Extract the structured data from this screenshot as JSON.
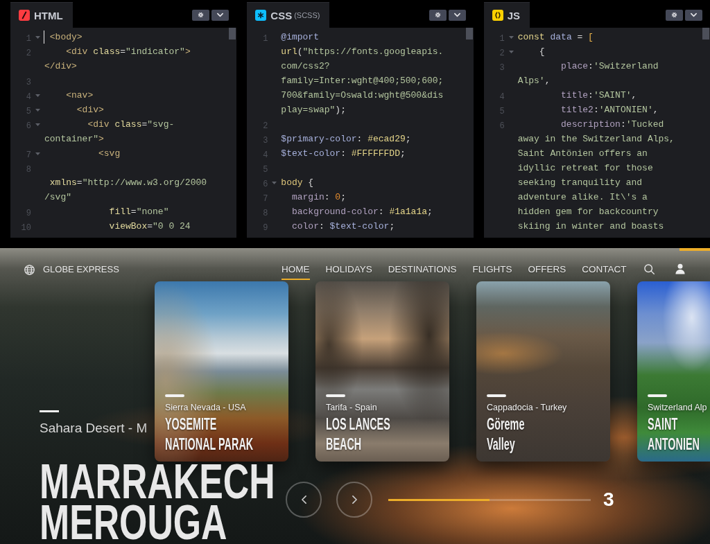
{
  "editors": [
    {
      "kind": "html",
      "label": "HTML",
      "lines": [
        {
          "number": "1",
          "fold": true,
          "cursor": true,
          "segments": [
            {
              "kind": "tag",
              "text": " <body>"
            }
          ]
        },
        {
          "number": "2",
          "fold": false,
          "segments": [
            {
              "kind": "tag",
              "text": "    <div"
            },
            {
              "kind": "attribute",
              "text": " class"
            },
            {
              "kind": "punctuation",
              "text": "="
            },
            {
              "kind": "string",
              "text": "\"indicator\""
            },
            {
              "kind": "tag",
              "text": ">\n</div>"
            }
          ]
        },
        {
          "number": "3",
          "fold": false
        },
        {
          "number": "4",
          "fold": true,
          "segments": [
            {
              "kind": "tag",
              "text": "    <nav>"
            }
          ]
        },
        {
          "number": "5",
          "fold": true,
          "segments": [
            {
              "kind": "tag",
              "text": "      <div>"
            }
          ]
        },
        {
          "number": "6",
          "fold": true,
          "segments": [
            {
              "kind": "tag",
              "text": "        <div"
            },
            {
              "kind": "attribute",
              "text": " class"
            },
            {
              "kind": "punctuation",
              "text": "="
            },
            {
              "kind": "string",
              "text": "\"svg-\ncontainer\""
            },
            {
              "kind": "tag",
              "text": ">"
            }
          ]
        },
        {
          "number": "7",
          "fold": true,
          "segments": [
            {
              "kind": "tag",
              "text": "          <svg"
            }
          ]
        },
        {
          "number": "8",
          "fold": false,
          "segments": [
            {
              "kind": "attribute",
              "text": "            \n xmlns"
            },
            {
              "kind": "punctuation",
              "text": "="
            },
            {
              "kind": "string",
              "text": "\"http://www.w3.org/2000\n/svg\""
            }
          ]
        },
        {
          "number": "9",
          "fold": false,
          "segments": [
            {
              "kind": "attribute",
              "text": "            fill"
            },
            {
              "kind": "punctuation",
              "text": "="
            },
            {
              "kind": "string",
              "text": "\"none\""
            }
          ]
        },
        {
          "number": "10",
          "fold": false,
          "segments": [
            {
              "kind": "attribute",
              "text": "            viewBox"
            },
            {
              "kind": "punctuation",
              "text": "="
            },
            {
              "kind": "string",
              "text": "\"0 0 24"
            }
          ]
        }
      ]
    },
    {
      "kind": "css",
      "label": "CSS",
      "preprocessor": "(SCSS)",
      "lines": [
        {
          "number": "1",
          "fold": false,
          "segments": [
            {
              "kind": "at-rule",
              "text": "@import"
            },
            {
              "kind": "function",
              "text": "\nurl"
            },
            {
              "kind": "punctuation",
              "text": "("
            },
            {
              "kind": "string",
              "text": "\"https://fonts.googleapis.\ncom/css2?\nfamily=Inter:wght@400;500;600;\n700&family=Oswald:wght@500&dis\nplay=swap\""
            },
            {
              "kind": "punctuation",
              "text": ");"
            }
          ]
        },
        {
          "number": "2",
          "fold": false
        },
        {
          "number": "3",
          "fold": false,
          "segments": [
            {
              "kind": "variable",
              "text": "$primary-color"
            },
            {
              "kind": "punctuation",
              "text": ": "
            },
            {
              "kind": "value",
              "text": "#ecad29"
            },
            {
              "kind": "punctuation",
              "text": ";"
            }
          ]
        },
        {
          "number": "4",
          "fold": false,
          "segments": [
            {
              "kind": "variable",
              "text": "$text-color"
            },
            {
              "kind": "punctuation",
              "text": ": "
            },
            {
              "kind": "value",
              "text": "#FFFFFFDD"
            },
            {
              "kind": "punctuation",
              "text": ";"
            }
          ]
        },
        {
          "number": "5",
          "fold": false
        },
        {
          "number": "6",
          "fold": true,
          "segments": [
            {
              "kind": "selector",
              "text": "body"
            },
            {
              "kind": "punctuation",
              "text": " {"
            }
          ]
        },
        {
          "number": "7",
          "fold": false,
          "segments": [
            {
              "kind": "property",
              "text": "  margin"
            },
            {
              "kind": "punctuation",
              "text": ": "
            },
            {
              "kind": "number",
              "text": "0"
            },
            {
              "kind": "punctuation",
              "text": ";"
            }
          ]
        },
        {
          "number": "8",
          "fold": false,
          "segments": [
            {
              "kind": "property",
              "text": "  background-color"
            },
            {
              "kind": "punctuation",
              "text": ": "
            },
            {
              "kind": "value",
              "text": "#1a1a1a"
            },
            {
              "kind": "punctuation",
              "text": ";"
            }
          ]
        },
        {
          "number": "9",
          "fold": false,
          "segments": [
            {
              "kind": "property",
              "text": "  color"
            },
            {
              "kind": "punctuation",
              "text": ": "
            },
            {
              "kind": "variable",
              "text": "$text-color"
            },
            {
              "kind": "punctuation",
              "text": ";"
            }
          ]
        }
      ]
    },
    {
      "kind": "js",
      "label": "JS",
      "lines": [
        {
          "number": "1",
          "fold": true,
          "segments": [
            {
              "kind": "keyword",
              "text": "const"
            },
            {
              "kind": "variable",
              "text": " data"
            },
            {
              "kind": "punctuation",
              "text": " ="
            },
            {
              "kind": "bracket",
              "text": " ["
            }
          ]
        },
        {
          "number": "2",
          "fold": true,
          "segments": [
            {
              "kind": "punctuation",
              "text": "    {"
            }
          ]
        },
        {
          "number": "3",
          "fold": false,
          "segments": [
            {
              "kind": "property",
              "text": "        place"
            },
            {
              "kind": "punctuation",
              "text": ":"
            },
            {
              "kind": "string",
              "text": "'Switzerland\nAlps'"
            },
            {
              "kind": "punctuation",
              "text": ","
            }
          ]
        },
        {
          "number": "4",
          "fold": false,
          "segments": [
            {
              "kind": "property",
              "text": "        title"
            },
            {
              "kind": "punctuation",
              "text": ":"
            },
            {
              "kind": "string",
              "text": "'SAINT'"
            },
            {
              "kind": "punctuation",
              "text": ","
            }
          ]
        },
        {
          "number": "5",
          "fold": false,
          "segments": [
            {
              "kind": "property",
              "text": "        title2"
            },
            {
              "kind": "punctuation",
              "text": ":"
            },
            {
              "kind": "string",
              "text": "'ANTONIEN'"
            },
            {
              "kind": "punctuation",
              "text": ","
            }
          ]
        },
        {
          "number": "6",
          "fold": false,
          "segments": [
            {
              "kind": "property",
              "text": "        description"
            },
            {
              "kind": "punctuation",
              "text": ":"
            },
            {
              "kind": "string",
              "text": "'Tucked\naway in the Switzerland Alps,\nSaint Antönien offers an\nidyllic retreat for those\nseeking tranquility and\nadventure alike. It\\'s a\nhidden gem for backcountry\nskiing in winter and boasts"
            }
          ]
        }
      ]
    }
  ],
  "site": {
    "brand": "GLOBE EXPRESS",
    "nav": [
      {
        "label": "HOME",
        "selected": true
      },
      {
        "label": "HOLIDAYS",
        "selected": false
      },
      {
        "label": "DESTINATIONS",
        "selected": false
      },
      {
        "label": "FLIGHTS",
        "selected": false
      },
      {
        "label": "OFFERS",
        "selected": false
      },
      {
        "label": "CONTACT",
        "selected": false
      }
    ]
  },
  "hero": {
    "place": "Sahara Desert - M",
    "title": "MARRAKECH",
    "title2": "MEROUGA"
  },
  "cards": [
    {
      "place": "Sierra Nevada - USA",
      "title": "YOSEMITE",
      "title2": "NATIONAL PARAK"
    },
    {
      "place": "Tarifa - Spain",
      "title": "LOS LANCES",
      "title2": "BEACH"
    },
    {
      "place": "Cappadocia - Turkey",
      "title": "Göreme",
      "title2": "Valley"
    },
    {
      "place": "Switzerland Alp",
      "title": "SAINT",
      "title2": "ANTONIEN"
    }
  ],
  "slider": {
    "level": 0.5,
    "counter": "3"
  }
}
